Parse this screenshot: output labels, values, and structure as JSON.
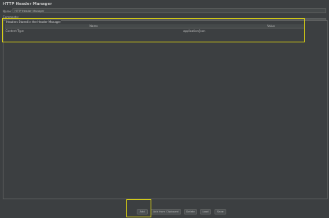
{
  "panel": {
    "title": "HTTP Header Manager",
    "name_label": "Name:",
    "name_value": "HTTP Header Manager",
    "comments_label": "Comments:"
  },
  "headers": {
    "title": "Headers Stored in the Header Manager",
    "columns": [
      "Name",
      "Value"
    ],
    "rows": [
      {
        "name": "Content-Type",
        "value": "application/json"
      }
    ]
  },
  "buttons": {
    "add": "Add",
    "add_clipboard": "Add from Clipboard",
    "delete": "Delete",
    "load": "Load",
    "save": "Save"
  },
  "colors": {
    "background": "#3c3f41",
    "highlight": "#e3d90f"
  }
}
